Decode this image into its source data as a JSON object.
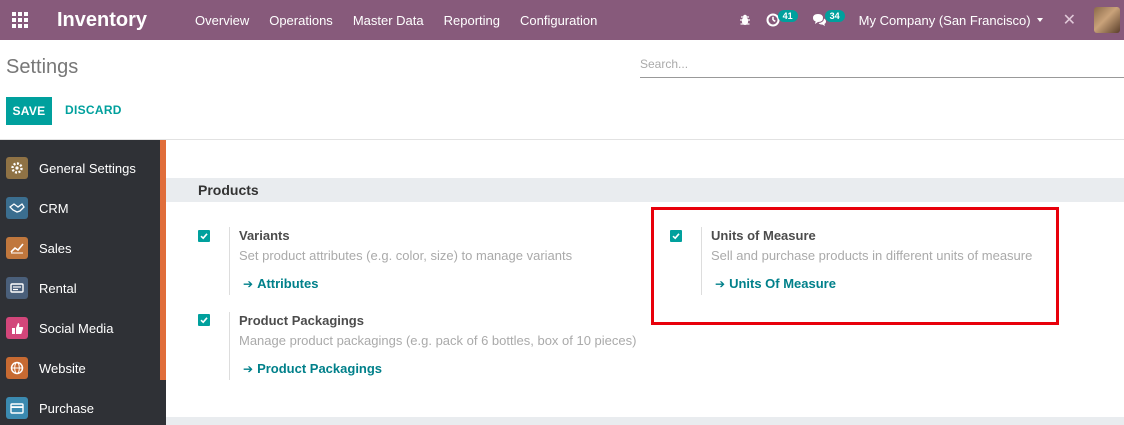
{
  "navbar": {
    "brand": "Inventory",
    "menu": [
      "Overview",
      "Operations",
      "Master Data",
      "Reporting",
      "Configuration"
    ],
    "activity_count": "41",
    "message_count": "34",
    "company": "My Company (San Francisco)",
    "background_color": "#875a7b"
  },
  "control_panel": {
    "title": "Settings",
    "search_placeholder": "Search...",
    "save_label": "SAVE",
    "discard_label": "DISCARD"
  },
  "sidebar": {
    "items": [
      {
        "label": "General Settings",
        "icon": "gear-icon",
        "color": "#8f7245"
      },
      {
        "label": "CRM",
        "icon": "handshake-icon",
        "color": "#3b6e8f"
      },
      {
        "label": "Sales",
        "icon": "chart-icon",
        "color": "#c0773d"
      },
      {
        "label": "Rental",
        "icon": "cash-icon",
        "color": "#4a5f7a"
      },
      {
        "label": "Social Media",
        "icon": "thumbs-up-icon",
        "color": "#d2467a"
      },
      {
        "label": "Website",
        "icon": "globe-icon",
        "color": "#c76a32"
      },
      {
        "label": "Purchase",
        "icon": "card-icon",
        "color": "#3b8ab0"
      }
    ]
  },
  "section": {
    "title": "Products",
    "settings": [
      {
        "label": "Variants",
        "description": "Set product attributes (e.g. color, size) to manage variants",
        "link": "Attributes",
        "checked": true
      },
      {
        "label": "Units of Measure",
        "description": "Sell and purchase products in different units of measure",
        "link": "Units Of Measure",
        "checked": true
      },
      {
        "label": "Product Packagings",
        "description": "Manage product packagings (e.g. pack of 6 bottles, box of 10 pieces)",
        "link": "Product Packagings",
        "checked": true
      }
    ]
  },
  "colors": {
    "accent": "#00a09d",
    "link": "#00808a",
    "highlight": "#e8000b"
  }
}
